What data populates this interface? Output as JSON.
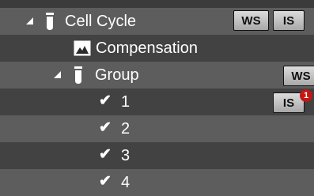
{
  "tree": {
    "root": {
      "label": "Cell Cycle",
      "ws_badge": "WS",
      "is_badge": "IS"
    },
    "compensation": {
      "label": "Compensation"
    },
    "group": {
      "label": "Group",
      "ws_badge": "WS"
    },
    "items": [
      {
        "label": "1",
        "is_badge": "IS",
        "alert_count": "1"
      },
      {
        "label": "2"
      },
      {
        "label": "3"
      },
      {
        "label": "4"
      }
    ]
  },
  "colors": {
    "row_dark": "#424242",
    "row_light": "#5d5d5d",
    "alert": "#c41616",
    "badge_bg": "#c8c8c8"
  },
  "icons": [
    "collapse-triangle-icon",
    "tube-icon",
    "chart-image-icon",
    "checkmark-icon"
  ]
}
